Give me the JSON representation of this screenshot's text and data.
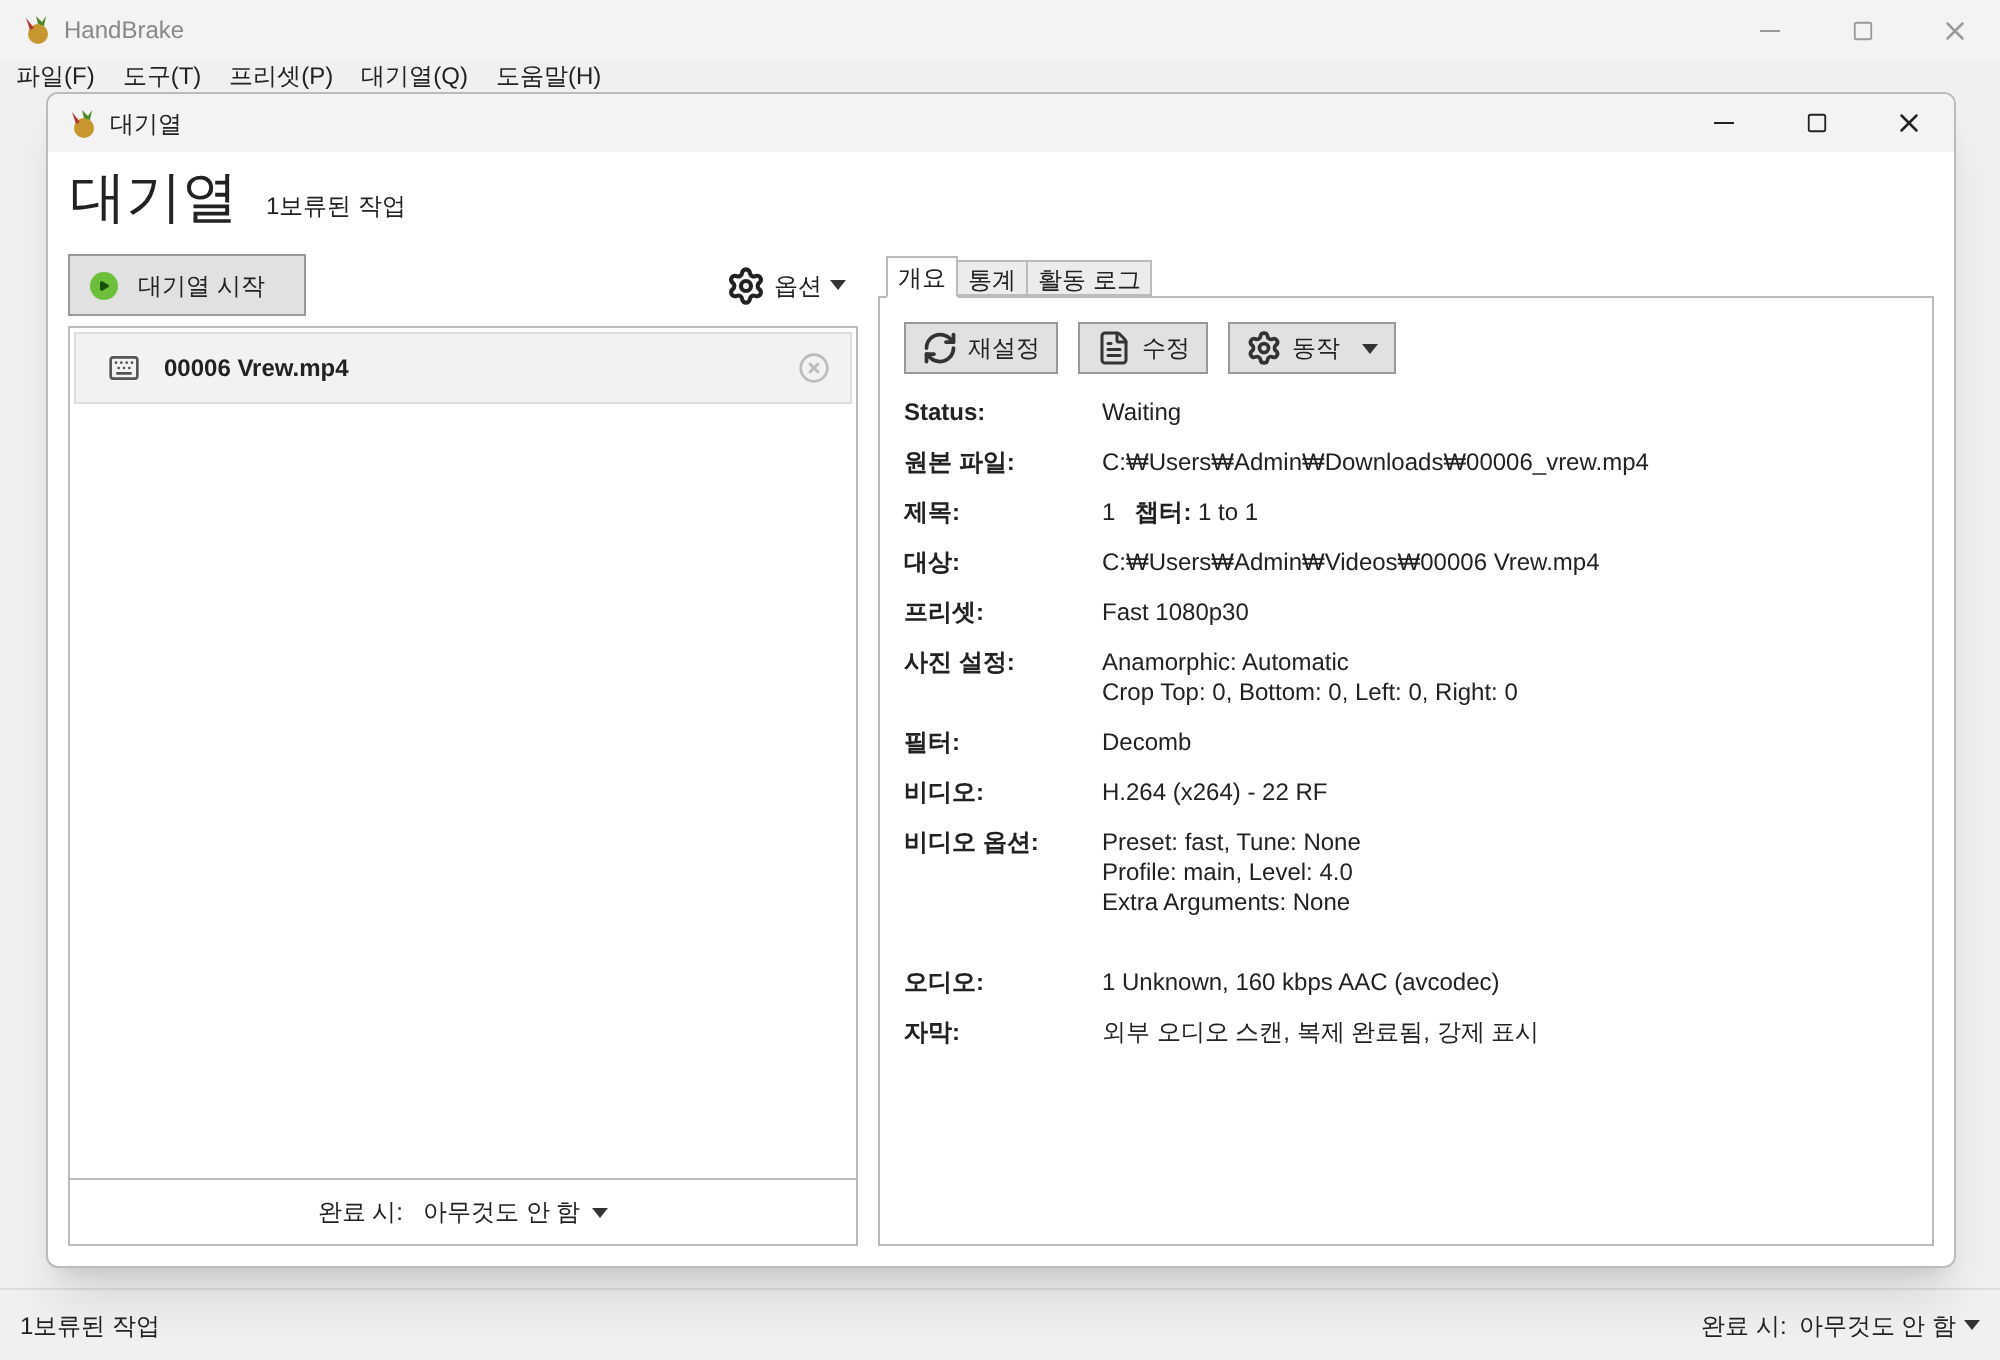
{
  "main_window": {
    "title": "HandBrake",
    "menu": [
      "파일(F)",
      "도구(T)",
      "프리셋(P)",
      "대기열(Q)",
      "도움말(H)"
    ],
    "status_bar": {
      "left": "1보류된 작업",
      "right_label": "완료 시:",
      "right_value": "아무것도 안 함"
    }
  },
  "queue_window": {
    "title": "대기열",
    "heading": "대기열",
    "subheading": "1보류된 작업",
    "start_button": "대기열 시작",
    "options_button": "옵션",
    "jobs": [
      {
        "name": "00006 Vrew.mp4",
        "selected": true
      }
    ],
    "when_done_label": "완료 시:",
    "when_done_value": "아무것도 안 함",
    "tabs": [
      {
        "label": "개요",
        "selected": true
      },
      {
        "label": "통계",
        "selected": false
      },
      {
        "label": "활동 로그",
        "selected": false
      }
    ],
    "actions": [
      {
        "kind": "reset",
        "label": "재설정"
      },
      {
        "kind": "edit",
        "label": "수정"
      },
      {
        "kind": "menu",
        "label": "동작"
      }
    ],
    "details": [
      {
        "label": "Status:",
        "values": [
          "Waiting"
        ]
      },
      {
        "label": "원본 파일:",
        "values": [
          "C:₩Users₩Admin₩Downloads₩00006_vrew.mp4"
        ]
      },
      {
        "label": "제목:",
        "values": [
          "1   **챕터:** 1 to 1"
        ]
      },
      {
        "label": "대상:",
        "values": [
          "C:₩Users₩Admin₩Videos₩00006 Vrew.mp4"
        ]
      },
      {
        "label": "프리셋:",
        "values": [
          "Fast 1080p30"
        ]
      },
      {
        "label": "사진 설정:",
        "values": [
          "Anamorphic: Automatic",
          "Crop Top: 0, Bottom: 0, Left: 0, Right: 0"
        ]
      },
      {
        "label": "필터:",
        "values": [
          "Decomb"
        ]
      },
      {
        "label": "비디오:",
        "values": [
          "H.264 (x264) - 22 RF"
        ]
      },
      {
        "label": "비디오 옵션:",
        "values": [
          "Preset: fast, Tune: None",
          "Profile: main, Level: 4.0",
          "Extra Arguments: None"
        ],
        "gap_after": true
      },
      {
        "label": "오디오:",
        "values": [
          "1 Unknown, 160 kbps AAC (avcodec)"
        ]
      },
      {
        "label": "자막:",
        "values": [
          "외부 오디오 스캔, 복제 완료됨, 강제 표시"
        ]
      }
    ]
  }
}
